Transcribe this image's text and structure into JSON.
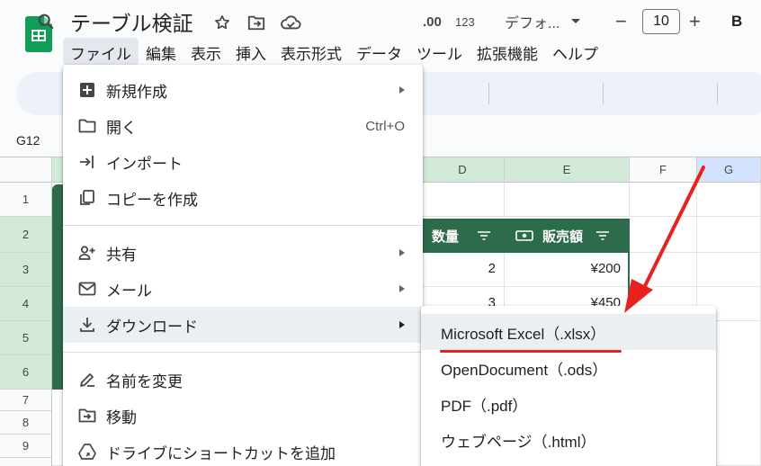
{
  "app": {
    "title": "テーブル検証",
    "icons": [
      "star-icon",
      "folder-move-icon",
      "cloud-status-icon"
    ],
    "accent": "#0f9d58"
  },
  "menubar": [
    "ファイル",
    "編集",
    "表示",
    "挿入",
    "表示形式",
    "データ",
    "ツール",
    "拡張機能",
    "ヘルプ"
  ],
  "toolbar": {
    "format_123": "123",
    "font_name": "デフォ...",
    "font_size": "10",
    "bold": "B"
  },
  "namebox": "G12",
  "columns": [
    "D",
    "E",
    "F",
    "G"
  ],
  "rows": [
    "1",
    "2",
    "3",
    "4",
    "5",
    "6",
    "7",
    "8",
    "9"
  ],
  "table": {
    "headers": [
      "数量",
      "販売額"
    ],
    "rows": [
      {
        "qty": "2",
        "amount": "¥200"
      },
      {
        "qty": "3",
        "amount": "¥450"
      }
    ],
    "header_color": "#2e6b4d"
  },
  "file_menu": {
    "items": [
      {
        "label": "新規作成",
        "icon": "new-sheet-icon",
        "submenu": true
      },
      {
        "label": "開く",
        "icon": "folder-icon",
        "shortcut": "Ctrl+O"
      },
      {
        "label": "インポート",
        "icon": "import-icon"
      },
      {
        "label": "コピーを作成",
        "icon": "copy-icon"
      },
      {
        "label": "共有",
        "icon": "share-person-icon",
        "submenu": true
      },
      {
        "label": "メール",
        "icon": "mail-icon",
        "submenu": true
      },
      {
        "label": "ダウンロード",
        "icon": "download-icon",
        "submenu": true
      },
      {
        "label": "名前を変更",
        "icon": "rename-icon"
      },
      {
        "label": "移動",
        "icon": "move-icon"
      },
      {
        "label": "ドライブにショートカットを追加",
        "icon": "drive-shortcut-icon"
      }
    ]
  },
  "download_submenu": {
    "items": [
      "Microsoft Excel（.xlsx）",
      "OpenDocument（.ods）",
      "PDF（.pdf）",
      "ウェブページ（.html）"
    ]
  },
  "annotation": {
    "color": "#e8211e"
  }
}
